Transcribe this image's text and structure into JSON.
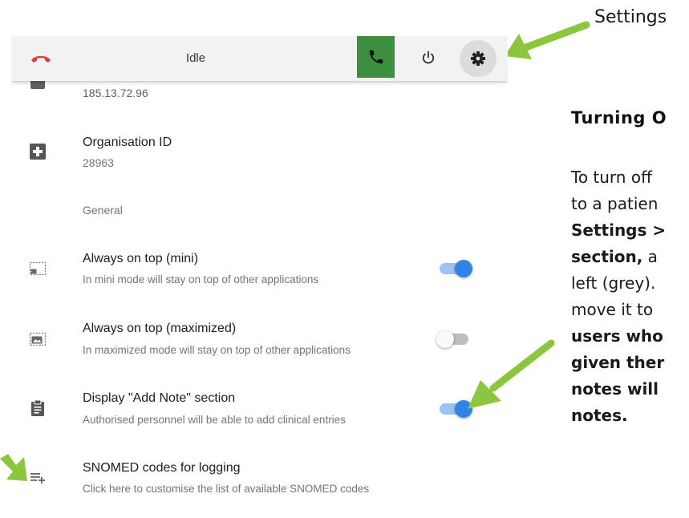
{
  "toolbar": {
    "status": "Idle",
    "icons": [
      "hangup-icon",
      "phone-icon",
      "power-icon",
      "gear-icon"
    ],
    "call_button_color": "#3d8f3f",
    "hangup_color": "#e53935"
  },
  "settings": {
    "ip_address": "185.13.72.96",
    "organisation": {
      "title": "Organisation ID",
      "value": "28963"
    },
    "section_general": "General",
    "rows": [
      {
        "title": "Always on top (mini)",
        "subtitle": "In mini mode will stay on top of other applications",
        "toggle": "on"
      },
      {
        "title": "Always on top (maximized)",
        "subtitle": "In maximized mode will stay on top of other applications",
        "toggle": "off"
      },
      {
        "title": "Display \"Add Note\" section",
        "subtitle": "Authorised personnel will be able to add clinical entries",
        "toggle": "on"
      },
      {
        "title": "SNOMED codes for logging",
        "subtitle": "Click here to customise the list of available SNOMED codes"
      }
    ],
    "toggle_accent": "#2f84e6"
  },
  "annotation": {
    "settings_label": "Settings",
    "heading": "Turning O",
    "body_lines": [
      {
        "text": "To turn off",
        "bold": false
      },
      {
        "text": "to a patien",
        "bold": false
      },
      {
        "text": "Settings >",
        "bold": true
      },
      {
        "text": "section,",
        "bold": true,
        "tail": " a"
      },
      {
        "text": "left (grey).",
        "bold": false
      },
      {
        "text": "move it to",
        "bold": false
      },
      {
        "text": "users who",
        "bold": true
      },
      {
        "text": "given ther",
        "bold": true
      },
      {
        "text": "notes will",
        "bold": true
      },
      {
        "text": "notes.",
        "bold": true
      }
    ],
    "arrow_color": "#8cc63f"
  }
}
